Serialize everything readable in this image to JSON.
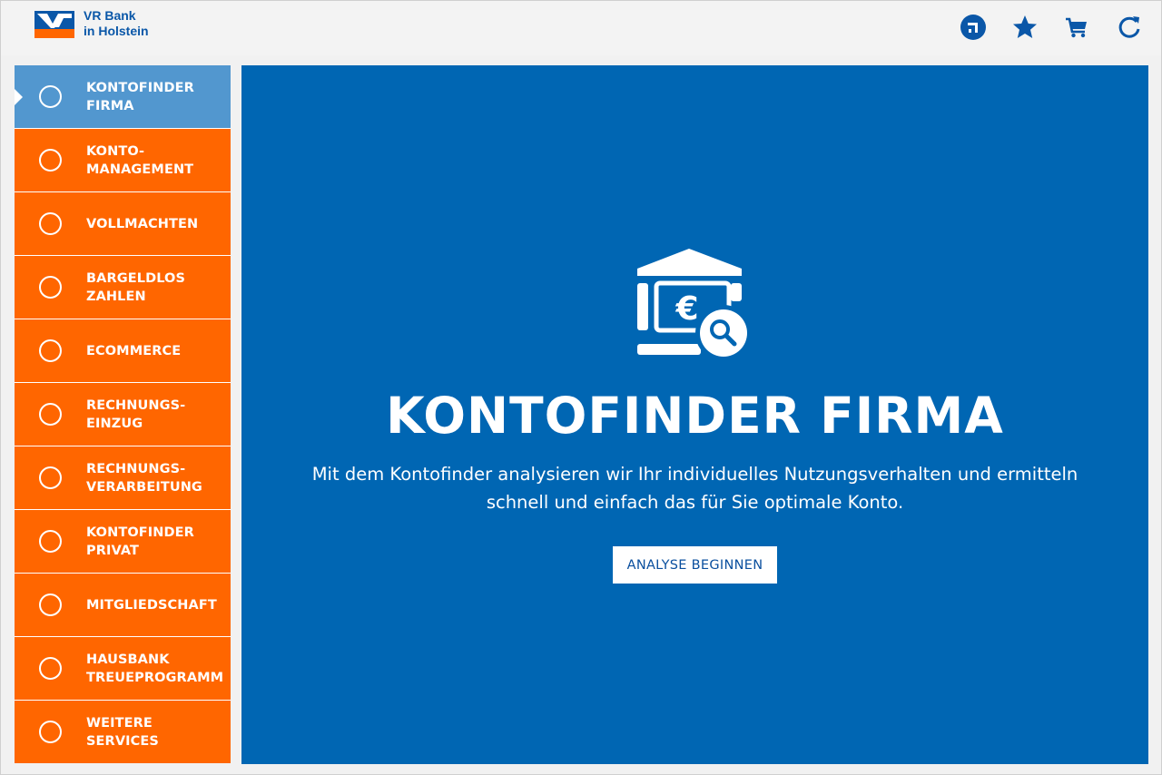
{
  "header": {
    "bank_name_line1": "VR Bank",
    "bank_name_line2": "in Holstein",
    "icons": [
      "share-icon",
      "star-icon",
      "cart-icon",
      "refresh-icon"
    ]
  },
  "sidebar": {
    "items": [
      {
        "label": "KONTOFINDER\nFIRMA",
        "active": true
      },
      {
        "label": "KONTO-\nMANAGEMENT",
        "active": false
      },
      {
        "label": "VOLLMACHTEN",
        "active": false
      },
      {
        "label": "BARGELDLOS\nZAHLEN",
        "active": false
      },
      {
        "label": "ECOMMERCE",
        "active": false
      },
      {
        "label": "RECHNUNGS-\nEINZUG",
        "active": false
      },
      {
        "label": "RECHNUNGS-\nVERARBEITUNG",
        "active": false
      },
      {
        "label": "KONTOFINDER\nPRIVAT",
        "active": false
      },
      {
        "label": "MITGLIEDSCHAFT",
        "active": false
      },
      {
        "label": "HAUSBANK\nTREUEPROGRAMM",
        "active": false
      },
      {
        "label": "WEITERE\nSERVICES",
        "active": false
      }
    ]
  },
  "main": {
    "icon": "bank-euro-search-icon",
    "title": "KONTOFINDER FIRMA",
    "description": "Mit dem Kontofinder analysieren wir Ihr individuelles Nutzungsverhalten und ermitteln schnell und einfach das für Sie optimale Konto.",
    "cta_label": "ANALYSE BEGINNEN"
  },
  "colors": {
    "brand_blue": "#0066b3",
    "nav_orange": "#ff6600",
    "nav_active": "#5297cf",
    "header_icon": "#0a57a8"
  }
}
